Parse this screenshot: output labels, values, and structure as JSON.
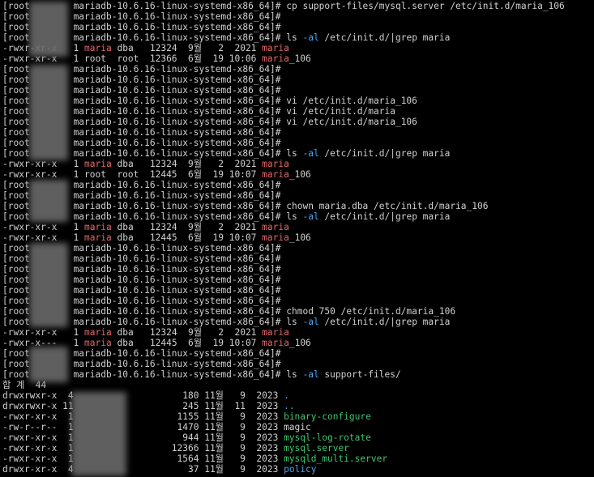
{
  "terminal": {
    "colors": {
      "background": "#000000",
      "text": "#d0d0d0",
      "highlight": "#e0676b",
      "option": "#4aa3e8",
      "listing": "#3fc46d"
    },
    "lines": [
      {
        "segs": [
          {
            "t": "[root"
          },
          {
            "t": "        mariadb-10.6.16-linux-systemd-x86_64]# cp support-files/mysql.server /etc/init.d/maria_106"
          }
        ]
      },
      {
        "segs": [
          {
            "t": "[root"
          },
          {
            "t": "        mariadb-10.6.16-linux-systemd-x86_64]#"
          }
        ]
      },
      {
        "segs": [
          {
            "t": "[root"
          },
          {
            "t": "        mariadb-10.6.16-linux-systemd-x86_64]#"
          }
        ]
      },
      {
        "segs": [
          {
            "t": "[root"
          },
          {
            "t": "        mariadb-10.6.16-linux-systemd-x86_64]# ls "
          },
          {
            "t": "-al",
            "c": "blue"
          },
          {
            "t": " /etc/init.d/|grep maria"
          }
        ]
      },
      {
        "segs": [
          {
            "t": "-rwxr-xr-x   1 "
          },
          {
            "t": "maria",
            "c": "red"
          },
          {
            "t": " dba   12324  9월   2  2021 "
          },
          {
            "t": "maria",
            "c": "red"
          }
        ]
      },
      {
        "segs": [
          {
            "t": "-rwxr-xr-x   1 root  root  12366  6월  19 10:06 "
          },
          {
            "t": "maria",
            "c": "red"
          },
          {
            "t": "_106"
          }
        ]
      },
      {
        "segs": [
          {
            "t": "[root"
          },
          {
            "t": "        mariadb-10.6.16-linux-systemd-x86_64]#"
          }
        ]
      },
      {
        "segs": [
          {
            "t": "[root"
          },
          {
            "t": "        mariadb-10.6.16-linux-systemd-x86_64]#"
          }
        ]
      },
      {
        "segs": [
          {
            "t": "[root"
          },
          {
            "t": "        mariadb-10.6.16-linux-systemd-x86_64]#"
          }
        ]
      },
      {
        "segs": [
          {
            "t": "[root"
          },
          {
            "t": "        mariadb-10.6.16-linux-systemd-x86_64]# vi /etc/init.d/maria_106"
          }
        ]
      },
      {
        "segs": [
          {
            "t": "[root"
          },
          {
            "t": "        mariadb-10.6.16-linux-systemd-x86_64]# vi /etc/init.d/maria"
          }
        ]
      },
      {
        "segs": [
          {
            "t": "[root"
          },
          {
            "t": "        mariadb-10.6.16-linux-systemd-x86_64]# vi /etc/init.d/maria_106"
          }
        ]
      },
      {
        "segs": [
          {
            "t": "[root"
          },
          {
            "t": "        mariadb-10.6.16-linux-systemd-x86_64]#"
          }
        ]
      },
      {
        "segs": [
          {
            "t": "[root"
          },
          {
            "t": "        mariadb-10.6.16-linux-systemd-x86_64]#"
          }
        ]
      },
      {
        "segs": [
          {
            "t": "[root"
          },
          {
            "t": "        mariadb-10.6.16-linux-systemd-x86_64]# ls "
          },
          {
            "t": "-al",
            "c": "blue"
          },
          {
            "t": " /etc/init.d/|grep maria"
          }
        ]
      },
      {
        "segs": [
          {
            "t": "-rwxr-xr-x   1 "
          },
          {
            "t": "maria",
            "c": "red"
          },
          {
            "t": " dba   12324  9월   2  2021 "
          },
          {
            "t": "maria",
            "c": "red"
          }
        ]
      },
      {
        "segs": [
          {
            "t": "-rwxr-xr-x   1 root  root  12445  6월  19 10:07 "
          },
          {
            "t": "maria",
            "c": "red"
          },
          {
            "t": "_106"
          }
        ]
      },
      {
        "segs": [
          {
            "t": "[root"
          },
          {
            "t": "        mariadb-10.6.16-linux-systemd-x86_64]#"
          }
        ]
      },
      {
        "segs": [
          {
            "t": "[root"
          },
          {
            "t": "        mariadb-10.6.16-linux-systemd-x86_64]#"
          }
        ]
      },
      {
        "segs": [
          {
            "t": "[root"
          },
          {
            "t": "        mariadb-10.6.16-linux-systemd-x86_64]# chown maria.dba /etc/init.d/maria_106"
          }
        ]
      },
      {
        "segs": [
          {
            "t": "[root"
          },
          {
            "t": "        mariadb-10.6.16-linux-systemd-x86_64]# ls "
          },
          {
            "t": "-al",
            "c": "blue"
          },
          {
            "t": " /etc/init.d/|grep maria"
          }
        ]
      },
      {
        "segs": [
          {
            "t": "-rwxr-xr-x   1 "
          },
          {
            "t": "maria",
            "c": "red"
          },
          {
            "t": " dba   12324  9월   2  2021 "
          },
          {
            "t": "maria",
            "c": "red"
          }
        ]
      },
      {
        "segs": [
          {
            "t": "-rwxr-xr-x   1 "
          },
          {
            "t": "maria",
            "c": "red"
          },
          {
            "t": " dba   12445  6월  19 10:07 "
          },
          {
            "t": "maria",
            "c": "red"
          },
          {
            "t": "_106"
          }
        ]
      },
      {
        "segs": [
          {
            "t": "[root"
          },
          {
            "t": "        mariadb-10.6.16-linux-systemd-x86_64]#"
          }
        ]
      },
      {
        "segs": [
          {
            "t": "[root"
          },
          {
            "t": "        mariadb-10.6.16-linux-systemd-x86_64]#"
          }
        ]
      },
      {
        "segs": [
          {
            "t": "[root"
          },
          {
            "t": "        mariadb-10.6.16-linux-systemd-x86_64]#"
          }
        ]
      },
      {
        "segs": [
          {
            "t": "[root"
          },
          {
            "t": "        mariadb-10.6.16-linux-systemd-x86_64]#"
          }
        ]
      },
      {
        "segs": [
          {
            "t": "[root"
          },
          {
            "t": "        mariadb-10.6.16-linux-systemd-x86_64]#"
          }
        ]
      },
      {
        "segs": [
          {
            "t": "[root"
          },
          {
            "t": "        mariadb-10.6.16-linux-systemd-x86_64]#"
          }
        ]
      },
      {
        "segs": [
          {
            "t": "[root"
          },
          {
            "t": "        mariadb-10.6.16-linux-systemd-x86_64]# chmod 750 /etc/init.d/maria_106"
          }
        ]
      },
      {
        "segs": [
          {
            "t": "[root"
          },
          {
            "t": "        mariadb-10.6.16-linux-systemd-x86_64]# ls "
          },
          {
            "t": "-al",
            "c": "blue"
          },
          {
            "t": " /etc/init.d/|grep maria"
          }
        ]
      },
      {
        "segs": [
          {
            "t": "-rwxr-xr-x   1 "
          },
          {
            "t": "maria",
            "c": "red"
          },
          {
            "t": " dba   12324  9월   2  2021 "
          },
          {
            "t": "maria",
            "c": "red"
          }
        ]
      },
      {
        "segs": [
          {
            "t": "-rwxr-x---   1 "
          },
          {
            "t": "maria",
            "c": "red"
          },
          {
            "t": " dba   12445  6월  19 10:07 "
          },
          {
            "t": "maria",
            "c": "red"
          },
          {
            "t": "_106"
          }
        ]
      },
      {
        "segs": [
          {
            "t": "[root"
          },
          {
            "t": "        mariadb-10.6.16-linux-systemd-x86_64]#"
          }
        ]
      },
      {
        "segs": [
          {
            "t": "[root"
          },
          {
            "t": "        mariadb-10.6.16-linux-systemd-x86_64]#"
          }
        ]
      },
      {
        "segs": [
          {
            "t": "[root"
          },
          {
            "t": "        mariadb-10.6.16-linux-systemd-x86_64]# ls "
          },
          {
            "t": "-al",
            "c": "blue"
          },
          {
            "t": " support-files/"
          }
        ]
      },
      {
        "segs": [
          {
            "t": "합 계  44"
          }
        ]
      },
      {
        "segs": [
          {
            "t": "drwxrwxr-x  4                    180 11월   9  2023 "
          },
          {
            "t": ".",
            "c": "blue"
          }
        ]
      },
      {
        "segs": [
          {
            "t": "drwxrwxr-x 11                    245 11월  11  2023 "
          },
          {
            "t": "..",
            "c": "blue"
          }
        ]
      },
      {
        "segs": [
          {
            "t": "-rwxr-xr-x  1                   1155 11월   9  2023 "
          },
          {
            "t": "binary-configure",
            "c": "green"
          }
        ]
      },
      {
        "segs": [
          {
            "t": "-rw-r--r--  1                   1470 11월   9  2023 magic"
          }
        ]
      },
      {
        "segs": [
          {
            "t": "-rwxr-xr-x  1                    944 11월   9  2023 "
          },
          {
            "t": "mysql-log-rotate",
            "c": "green"
          }
        ]
      },
      {
        "segs": [
          {
            "t": "-rwxr-xr-x  1                  12366 11월   9  2023 "
          },
          {
            "t": "mysql.server",
            "c": "green"
          }
        ]
      },
      {
        "segs": [
          {
            "t": "-rwxr-xr-x  1                   1564 11월   9  2023 "
          },
          {
            "t": "mysqld_multi.server",
            "c": "green"
          }
        ]
      },
      {
        "segs": [
          {
            "t": "drwxr-xr-x  4                     37 11월   9  2023 "
          },
          {
            "t": "policy",
            "c": "blue"
          }
        ]
      }
    ]
  }
}
